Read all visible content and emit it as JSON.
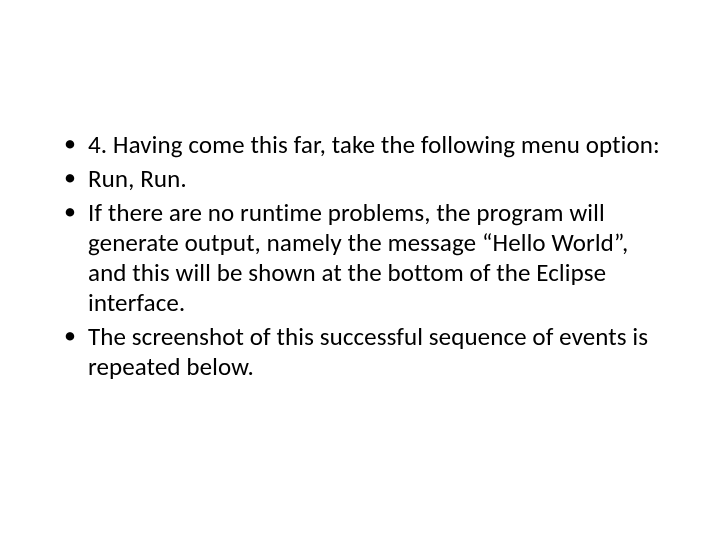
{
  "slide": {
    "bullets": [
      "4.  Having come this far, take the following menu option:",
      "Run, Run.",
      "If there are no runtime problems, the program will generate output, namely the message “Hello World”, and this will be shown at the bottom of the Eclipse interface.",
      "The screenshot of this successful sequence of events is repeated below."
    ]
  }
}
